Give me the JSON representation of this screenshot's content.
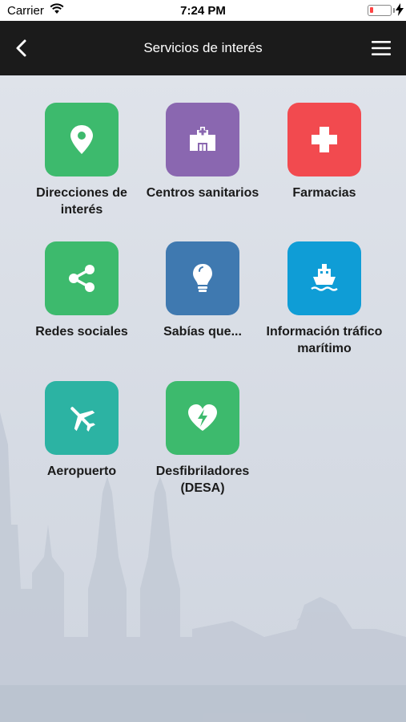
{
  "status_bar": {
    "carrier": "Carrier",
    "time": "7:24 PM"
  },
  "nav": {
    "title": "Servicios de interés"
  },
  "tiles": [
    {
      "label": "Direcciones de interés",
      "color": "#3dba6d",
      "icon": "location-pin-icon"
    },
    {
      "label": "Centros sanitarios",
      "color": "#8a67b0",
      "icon": "hospital-icon"
    },
    {
      "label": "Farmacias",
      "color": "#f24a4f",
      "icon": "pharmacy-cross-icon"
    },
    {
      "label": "Redes sociales",
      "color": "#3dba6d",
      "icon": "share-icon"
    },
    {
      "label": "Sabías que...",
      "color": "#3f79b0",
      "icon": "lightbulb-icon"
    },
    {
      "label": "Información tráfico marítimo",
      "color": "#0f9dd6",
      "icon": "ship-icon"
    },
    {
      "label": "Aeropuerto",
      "color": "#2cb3a3",
      "icon": "airplane-icon"
    },
    {
      "label": "Desfibriladores (DESA)",
      "color": "#3dba6d",
      "icon": "defibrillator-heart-icon"
    }
  ]
}
